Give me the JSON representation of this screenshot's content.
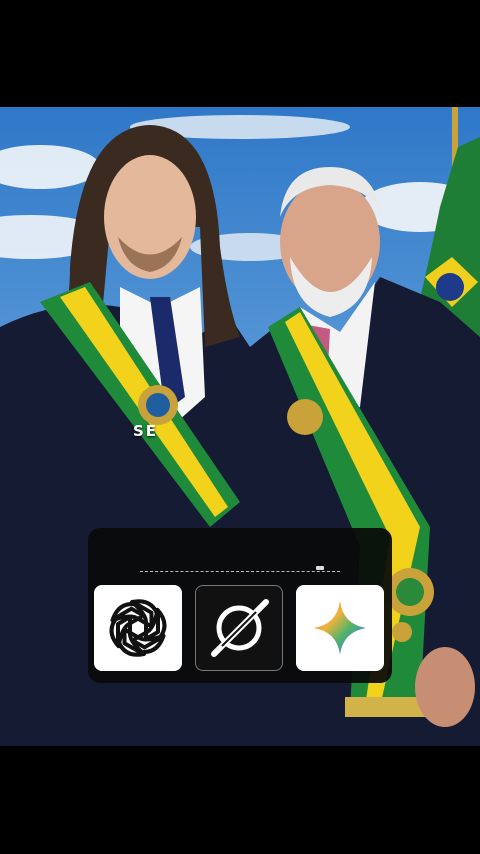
{
  "photo": {
    "caption": "SE"
  },
  "app_picker": {
    "apps": [
      {
        "name": "chatgpt-icon"
      },
      {
        "name": "grok-icon"
      },
      {
        "name": "gemini-icon"
      }
    ]
  },
  "colors": {
    "overlay": "#0a0a0a",
    "sash_green": "#1f8a3a",
    "sash_yellow": "#f2d21b",
    "suit": "#141b33"
  }
}
